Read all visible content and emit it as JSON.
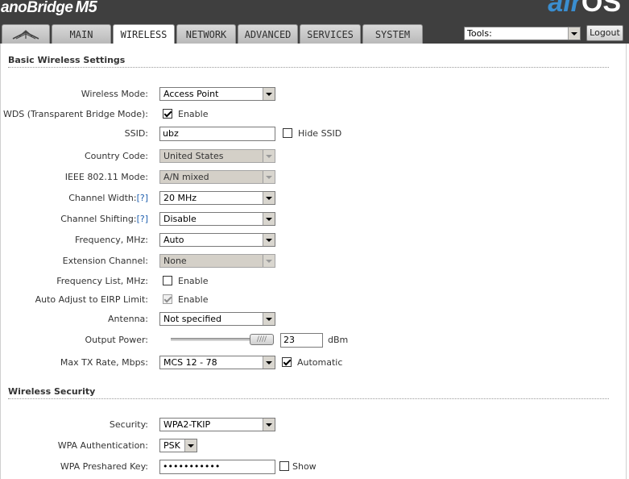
{
  "header": {
    "brand": "anoBridge",
    "model": "M5",
    "os_part1": "air",
    "os_part2": "OS"
  },
  "tabs": [
    {
      "label": "",
      "icon": "ubiquiti-logo-icon"
    },
    {
      "label": "MAIN"
    },
    {
      "label": "WIRELESS",
      "active": true
    },
    {
      "label": "NETWORK"
    },
    {
      "label": "ADVANCED"
    },
    {
      "label": "SERVICES"
    },
    {
      "label": "SYSTEM"
    }
  ],
  "tools": {
    "selected": "Tools:"
  },
  "logout_label": "Logout",
  "basic": {
    "title": "Basic Wireless Settings",
    "wireless_mode": {
      "label": "Wireless Mode:",
      "value": "Access Point"
    },
    "wds": {
      "label": "WDS (Transparent Bridge Mode):",
      "option": "Enable",
      "checked": true
    },
    "ssid": {
      "label": "SSID:",
      "value": "ubz",
      "hide_label": "Hide SSID",
      "hide_checked": false
    },
    "country": {
      "label": "Country Code:",
      "value": "United States"
    },
    "ieee": {
      "label": "IEEE 802.11 Mode:",
      "value": "A/N mixed"
    },
    "channel_width": {
      "label": "Channel Width:",
      "help": "[?]",
      "value": "20 MHz"
    },
    "channel_shifting": {
      "label": "Channel Shifting:",
      "help": "[?]",
      "value": "Disable"
    },
    "frequency": {
      "label": "Frequency, MHz:",
      "value": "Auto"
    },
    "extension": {
      "label": "Extension Channel:",
      "value": "None"
    },
    "freq_list": {
      "label": "Frequency List, MHz:",
      "option": "Enable",
      "checked": false
    },
    "eirp": {
      "label": "Auto Adjust to EIRP Limit:",
      "option": "Enable",
      "checked": true
    },
    "antenna": {
      "label": "Antenna:",
      "value": "Not specified"
    },
    "output_power": {
      "label": "Output Power:",
      "value": "23",
      "unit": "dBm",
      "level": 1.0
    },
    "max_tx": {
      "label": "Max TX Rate, Mbps:",
      "value": "MCS 12 - 78",
      "auto_label": "Automatic",
      "auto_checked": true
    }
  },
  "security": {
    "title": "Wireless Security",
    "security": {
      "label": "Security:",
      "value": "WPA2-TKIP"
    },
    "wpa_auth": {
      "label": "WPA Authentication:",
      "value": "PSK"
    },
    "psk": {
      "label": "WPA Preshared Key:",
      "value": "•••••••••••",
      "show_label": "Show",
      "show_checked": false
    }
  }
}
